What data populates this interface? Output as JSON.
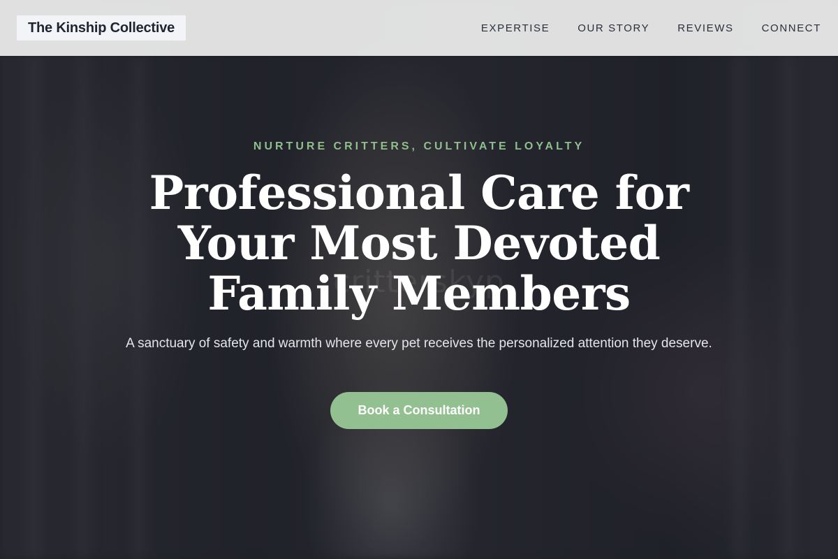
{
  "header": {
    "brand": "The Kinship Collective",
    "nav": [
      "EXPERTISE",
      "OUR STORY",
      "REVIEWS",
      "CONNECT"
    ]
  },
  "hero": {
    "tagline": "NURTURE CRITTERS, CULTIVATE LOYALTY",
    "headline": "Professional Care for Your Most Devoted Family Members",
    "subtext": "A sanctuary of safety and warmth where every pet receives the personalized attention they deserve.",
    "cta_label": "Book a Consultation",
    "watermark": "critterskyp"
  },
  "colors": {
    "accent": "#93c091",
    "tagline": "#8fbf8c",
    "header_bg": "#f0f0f0",
    "text_dark": "#1f2430"
  }
}
